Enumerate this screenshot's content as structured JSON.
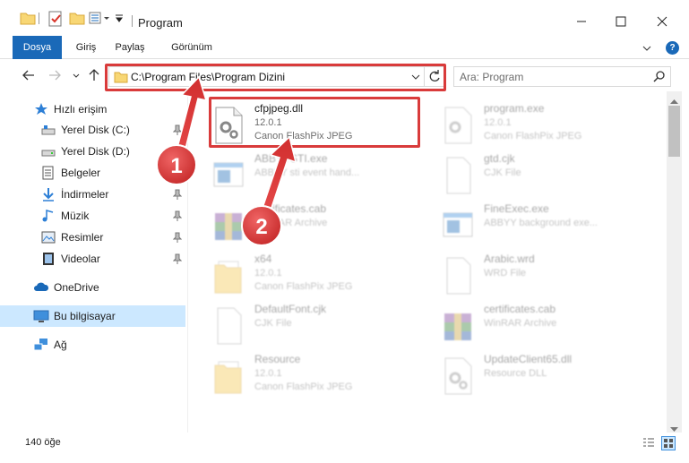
{
  "window": {
    "title": "Program",
    "controls": {
      "minimize": "minimize-icon",
      "maximize": "maximize-icon",
      "close": "close-icon"
    }
  },
  "ribbon": {
    "tabs": [
      {
        "label": "Dosya"
      },
      {
        "label": "Giriş"
      },
      {
        "label": "Paylaş"
      },
      {
        "label": "Görünüm"
      }
    ],
    "help_label": "?"
  },
  "navigation": {
    "address": "C:\\Program Files\\Program Dizini",
    "search_placeholder": "Ara: Program"
  },
  "sidebar": {
    "items": [
      {
        "label": "Hızlı erişim",
        "icon": "star-icon",
        "pinned": false
      },
      {
        "label": "Yerel Disk (C:)",
        "icon": "drive-icon",
        "pinned": true
      },
      {
        "label": "Yerel Disk (D:)",
        "icon": "drive-icon",
        "pinned": true
      },
      {
        "label": "Belgeler",
        "icon": "documents-icon",
        "pinned": true
      },
      {
        "label": "İndirmeler",
        "icon": "download-icon",
        "pinned": true
      },
      {
        "label": "Müzik",
        "icon": "music-icon",
        "pinned": true
      },
      {
        "label": "Resimler",
        "icon": "pictures-icon",
        "pinned": true
      },
      {
        "label": "Videolar",
        "icon": "videos-icon",
        "pinned": true
      },
      {
        "label": "OneDrive",
        "icon": "onedrive-icon",
        "pinned": false
      },
      {
        "label": "Bu bilgisayar",
        "icon": "computer-icon",
        "pinned": false,
        "selected": true
      },
      {
        "label": "Ağ",
        "icon": "network-icon",
        "pinned": false
      }
    ]
  },
  "files": [
    {
      "name": "cfpjpeg.dll",
      "line2": "12.0.1",
      "line3": "Canon FlashPix JPEG",
      "icon": "dll-gear-icon"
    },
    {
      "name": "program.exe",
      "line2": "12.0.1",
      "line3": "Canon FlashPix JPEG",
      "icon": "exe-icon"
    },
    {
      "name": "ABBYYSTI.exe",
      "line2": "ABBYY sti event hand...",
      "line3": "",
      "icon": "app-window-icon"
    },
    {
      "name": "gtd.cjk",
      "line2": "CJK File",
      "line3": "",
      "icon": "blank-file-icon"
    },
    {
      "name": "certificates.cab",
      "line2": "WinRAR Archive",
      "line3": "",
      "icon": "winrar-icon"
    },
    {
      "name": "FineExec.exe",
      "line2": "ABBYY background exe...",
      "line3": "",
      "icon": "app-window-icon"
    },
    {
      "name": "x64",
      "line2": "12.0.1",
      "line3": "Canon FlashPix JPEG",
      "icon": "folder-file-icon"
    },
    {
      "name": "Arabic.wrd",
      "line2": "WRD File",
      "line3": "",
      "icon": "blank-file-icon"
    },
    {
      "name": "DefaultFont.cjk",
      "line2": "CJK File",
      "line3": "",
      "icon": "blank-file-icon"
    },
    {
      "name": "certificates.cab",
      "line2": "WinRAR Archive",
      "line3": "",
      "icon": "winrar-icon"
    },
    {
      "name": "Resource",
      "line2": "12.0.1",
      "line3": "Canon FlashPix JPEG",
      "icon": "folder-file-icon"
    },
    {
      "name": "UpdateClient65.dll",
      "line2": "Resource DLL",
      "line3": "",
      "icon": "dll-gear-icon"
    }
  ],
  "status": {
    "item_count": "140 öğe"
  },
  "annotations": [
    {
      "label": "1"
    },
    {
      "label": "2"
    }
  ],
  "colors": {
    "accent": "#1a69b8",
    "highlight": "#d93b3b",
    "selected": "#cce8ff"
  }
}
